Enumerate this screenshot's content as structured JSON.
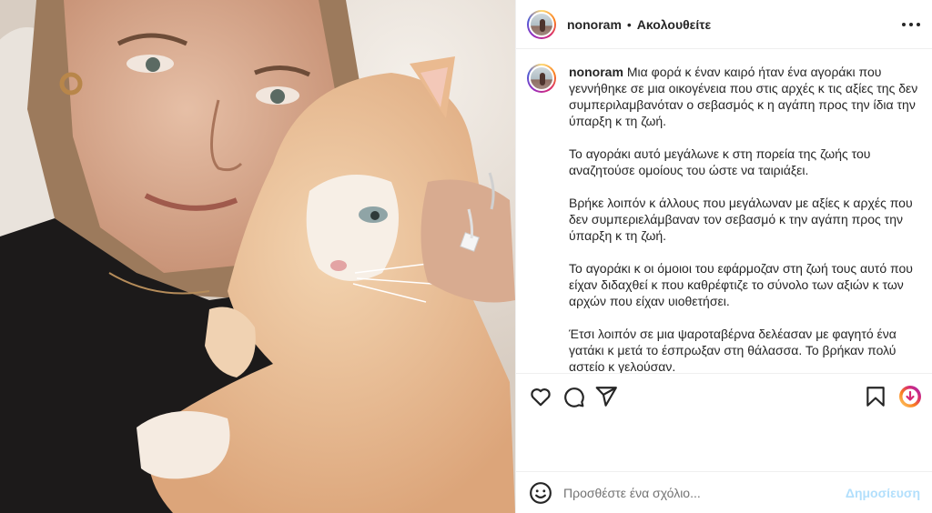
{
  "post": {
    "username": "nonoram",
    "separator": "•",
    "following_label": "Ακολουθείτε"
  },
  "caption": {
    "username": "nonoram",
    "paragraphs": [
      "Μια φορά κ έναν καιρό ήταν ένα αγοράκι που γεννήθηκε σε μια οικογένεια που στις αρχές κ τις αξίες της δεν συμπεριλαμβανόταν ο σεβασμός κ η αγάπη προς την ίδια την ύπαρξη κ τη ζωή.",
      "Το αγοράκι αυτό μεγάλωνε κ στη πορεία της ζωής του αναζητούσε ομοίους του ώστε να ταιριάξει.",
      "Βρήκε λοιπόν κ άλλους που μεγάλωναν με αξίες κ αρχές που δεν συμπεριελάμβαναν τον σεβασμό κ την αγάπη προς την ύπαρξη κ τη ζωή.",
      "Το αγοράκι κ οι όμοιοι του εφάρμοζαν στη ζωή τους αυτό που είχαν διδαχθεί κ που καθρέφτιζε το σύνολο των αξιών κ των αρχών που είχαν υιοθετήσει.",
      "Έτσι λοιπόν σε μια ψαροταβέρνα δελέασαν με φαγητό ένα γατάκι κ μετά το έσπρωξαν στη θάλασσα. Το βρήκαν πολύ αστείο κ γελούσαν."
    ]
  },
  "comment": {
    "placeholder": "Προσθέστε ένα σχόλιο...",
    "post_label": "Δημοσίευση"
  },
  "icons": {
    "more": "more-horizontal-icon",
    "like": "heart-icon",
    "comment": "comment-icon",
    "share": "send-icon",
    "save": "bookmark-icon",
    "emoji": "emoji-icon",
    "extension": "download-badge-icon"
  },
  "colors": {
    "post_button": "#b2dffc",
    "border": "#efefef",
    "text": "#262626",
    "placeholder": "#737373"
  }
}
